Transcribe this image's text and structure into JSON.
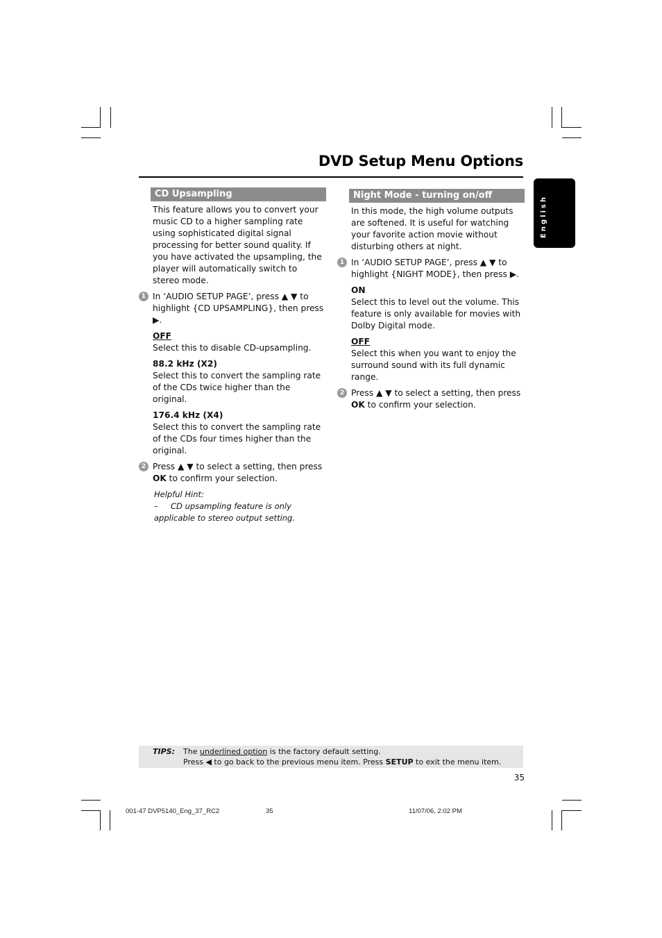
{
  "page": {
    "title": "DVD Setup Menu Options",
    "language_tab": "English",
    "page_number": "35"
  },
  "left": {
    "heading": "CD Upsampling",
    "intro": "This feature allows you to convert your music CD to a higher sampling rate using sophisticated digital signal processing for better sound quality. If you have activated the upsampling, the player will automatically switch to stereo mode.",
    "step1": {
      "num": "1",
      "text_a": "In ‘AUDIO SETUP PAGE’, press ▲ ▼ to highlight {CD UPSAMPLING}, then press ▶."
    },
    "options": [
      {
        "title": "OFF",
        "default": true,
        "desc": "Select this to disable CD-upsampling."
      },
      {
        "title": "88.2 kHz (X2)",
        "default": false,
        "desc": "Select this to convert the sampling rate of the CDs twice higher than the original."
      },
      {
        "title": "176.4 kHz (X4)",
        "default": false,
        "desc": "Select this to convert the sampling rate of the CDs four times higher than the original."
      }
    ],
    "step2": {
      "num": "2",
      "text_a": "Press ▲ ▼ to select a setting, then press ",
      "bold": "OK",
      "text_b": " to confirm your selection."
    },
    "hint_title": "Helpful Hint:",
    "hint_dash": "–",
    "hint_text": "CD upsampling feature is only applicable to stereo output setting."
  },
  "right": {
    "heading": "Night Mode - turning on/off",
    "intro": "In this mode, the high volume outputs are softened.  It is useful for watching your favorite action movie without disturbing others at night.",
    "step1": {
      "num": "1",
      "text_a": "In ‘AUDIO SETUP PAGE’, press ▲ ▼ to highlight {NIGHT MODE}, then press ▶."
    },
    "options": [
      {
        "title": "ON",
        "default": false,
        "desc": "Select this to level out the volume.  This feature is only available for movies with Dolby Digital mode."
      },
      {
        "title": "OFF",
        "default": true,
        "desc": "Select this when you want to enjoy the surround sound with its full dynamic range."
      }
    ],
    "step2": {
      "num": "2",
      "text_a": "Press ▲ ▼ to select a setting, then press ",
      "bold": "OK",
      "text_b": " to confirm your selection."
    }
  },
  "tips": {
    "label": "TIPS:",
    "line1_a": "The ",
    "line1_u": "underlined option",
    "line1_b": " is the factory default setting.",
    "line2_a": "Press ◀ to go back to the previous menu item. Press ",
    "line2_bold": "SETUP",
    "line2_b": " to exit the menu item."
  },
  "footer": {
    "file": "001-47 DVP5140_Eng_37_RC2",
    "page": "35",
    "date": "11/07/06, 2:02 PM"
  }
}
